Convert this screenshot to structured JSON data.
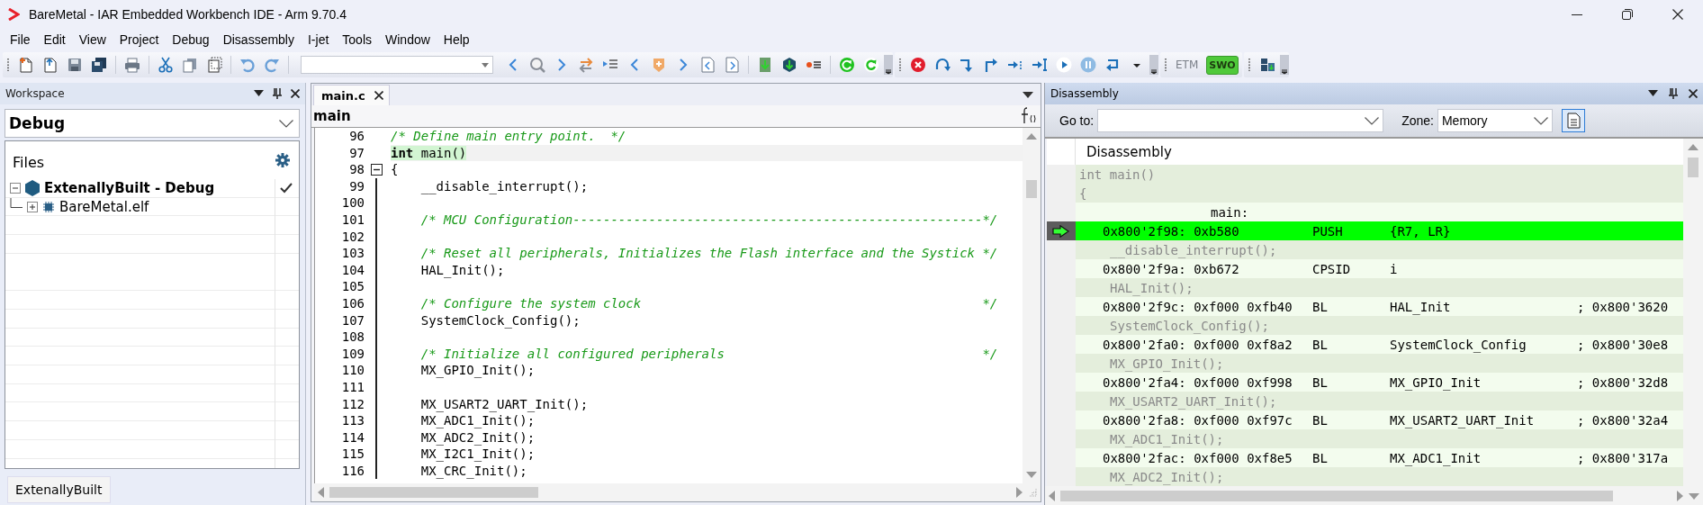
{
  "window": {
    "title": "BareMetal - IAR Embedded Workbench IDE - Arm 9.70.4"
  },
  "menu": [
    "File",
    "Edit",
    "View",
    "Project",
    "Debug",
    "Disassembly",
    "I-jet",
    "Tools",
    "Window",
    "Help"
  ],
  "toolbar": {
    "labels": [
      {
        "text": "ETM",
        "kind": "plain"
      },
      {
        "text": "SWO",
        "kind": "badge"
      }
    ]
  },
  "workspace": {
    "title": "Workspace",
    "configuration": "Debug",
    "files_header": "Files",
    "tree": [
      {
        "label": "ExtenallyBuilt - Debug",
        "expanded": true,
        "active": true,
        "children": [
          {
            "label": "BareMetal.elf",
            "expanded": false,
            "active": false
          }
        ]
      }
    ],
    "tabs": [
      {
        "label": "ExtenallyBuilt",
        "selected": true
      }
    ]
  },
  "editor": {
    "tabs": [
      {
        "label": "main.c",
        "selected": true
      }
    ],
    "function": "main",
    "lines": [
      {
        "number": "96",
        "text": "/* Define main entry point.  */",
        "kind": "comment",
        "current": false
      },
      {
        "number": "97",
        "text": "**int** main()",
        "kind": "code",
        "current": true
      },
      {
        "number": "98",
        "text": "{",
        "kind": "block_start",
        "current": false
      },
      {
        "number": "99",
        "text": "    __disable_interrupt();",
        "kind": "code",
        "current": false
      },
      {
        "number": "100",
        "kind": "code",
        "current": false
      },
      {
        "number": "101",
        "text": "    /* MCU Configuration------------------------------------------------------*/",
        "kind": "comment",
        "current": false
      },
      {
        "number": "102",
        "kind": "code",
        "current": false
      },
      {
        "number": "103",
        "text": "    /* Reset all peripherals, Initializes the Flash interface and the Systick */",
        "kind": "comment",
        "current": false
      },
      {
        "number": "104",
        "text": "    HAL_Init();",
        "kind": "code",
        "current": false
      },
      {
        "number": "105",
        "kind": "code",
        "current": false
      },
      {
        "number": "106",
        "text": "    /* Configure the system clock                                             */",
        "kind": "comment",
        "current": false
      },
      {
        "number": "107",
        "text": "    SystemClock_Config();",
        "kind": "code",
        "current": false
      },
      {
        "number": "108",
        "kind": "code",
        "current": false
      },
      {
        "number": "109",
        "text": "    /* Initialize all configured peripherals                                  */",
        "kind": "comment",
        "current": false
      },
      {
        "number": "110",
        "text": "    MX_GPIO_Init();",
        "kind": "code",
        "current": false
      },
      {
        "number": "111",
        "kind": "code",
        "current": false
      },
      {
        "number": "112",
        "text": "    MX_USART2_UART_Init();",
        "kind": "code",
        "current": false
      },
      {
        "number": "113",
        "text": "    MX_ADC1_Init();",
        "kind": "code",
        "current": false
      },
      {
        "number": "114",
        "text": "    MX_ADC2_Init();",
        "kind": "code",
        "current": false
      },
      {
        "number": "115",
        "text": "    MX_I2C1_Init();",
        "kind": "code",
        "current": false
      },
      {
        "number": "116",
        "text": "    MX_CRC_Init();",
        "kind": "code",
        "current": false
      }
    ]
  },
  "disassembly": {
    "title": "Disassembly",
    "goto_label": "Go to:",
    "zone_label": "Zone:",
    "zone": "Memory",
    "header": "Disassembly",
    "rows": [
      {
        "kind": "signature",
        "text": "int main()",
        "current": false
      },
      {
        "kind": "signature",
        "text": "{",
        "current": false
      },
      {
        "kind": "label",
        "text": "main:",
        "current": false
      },
      {
        "kind": "instruction",
        "address": "0x800'2f98: 0xb580",
        "mnemonic": "PUSH",
        "operands": "{R7, LR}",
        "current": true
      },
      {
        "kind": "statement",
        "text": "__disable_interrupt();",
        "current": false
      },
      {
        "kind": "instruction",
        "address": "0x800'2f9a: 0xb672",
        "mnemonic": "CPSID",
        "operands": "i",
        "current": false
      },
      {
        "kind": "statement",
        "text": "HAL_Init();",
        "current": false
      },
      {
        "kind": "instruction",
        "address": "0x800'2f9c: 0xf000 0xfb40",
        "mnemonic": "BL",
        "operands": "HAL_Init",
        "comment": "; 0x800'3620",
        "current": false
      },
      {
        "kind": "statement",
        "text": "SystemClock_Config();",
        "current": false
      },
      {
        "kind": "instruction",
        "address": "0x800'2fa0: 0xf000 0xf8a2",
        "mnemonic": "BL",
        "operands": "SystemClock_Config",
        "comment": "; 0x800'30e8",
        "current": false
      },
      {
        "kind": "statement",
        "text": "MX_GPIO_Init();",
        "current": false
      },
      {
        "kind": "instruction",
        "address": "0x800'2fa4: 0xf000 0xf998",
        "mnemonic": "BL",
        "operands": "MX_GPIO_Init",
        "comment": "; 0x800'32d8",
        "current": false
      },
      {
        "kind": "statement",
        "text": "MX_USART2_UART_Init();",
        "current": false
      },
      {
        "kind": "instruction",
        "address": "0x800'2fa8: 0xf000 0xf97c",
        "mnemonic": "BL",
        "operands": "MX_USART2_UART_Init",
        "comment": "; 0x800'32a4",
        "current": false
      },
      {
        "kind": "statement",
        "text": "MX_ADC1_Init();",
        "current": false
      },
      {
        "kind": "instruction",
        "address": "0x800'2fac: 0xf000 0xf8e5",
        "mnemonic": "BL",
        "operands": "MX_ADC1_Init",
        "comment": "; 0x800'317a",
        "current": false
      },
      {
        "kind": "statement",
        "text": "MX_ADC2_Init();",
        "current": false
      }
    ]
  }
}
